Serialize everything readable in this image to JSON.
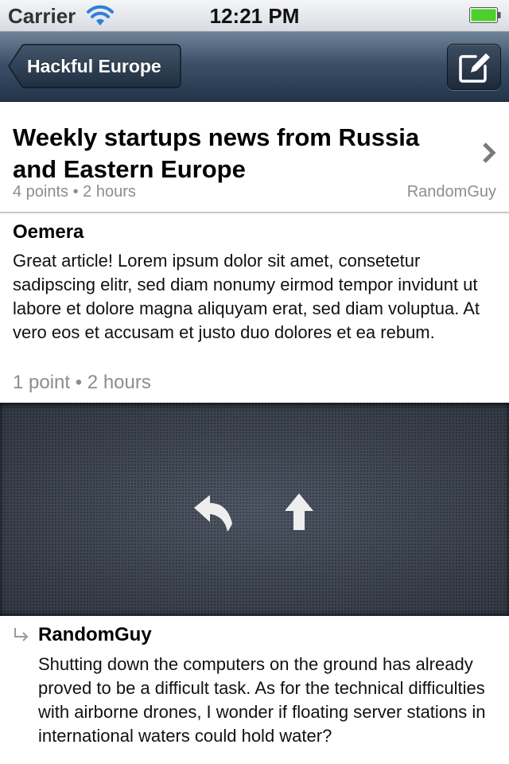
{
  "status_bar": {
    "carrier": "Carrier",
    "time": "12:21 PM",
    "wifi_icon": "wifi-icon",
    "battery_icon": "battery-icon"
  },
  "nav_bar": {
    "back_label": "Hackful Europe",
    "compose_icon": "compose-icon"
  },
  "story": {
    "title": "Weekly startups news from Russia and Eastern Europe",
    "meta": "4 points • 2 hours",
    "author": "RandomGuy",
    "chevron_icon": "chevron-right-icon"
  },
  "comments": [
    {
      "author": "Oemera",
      "text": "Great article! Lorem ipsum dolor sit amet, consetetur sadipscing elitr, sed diam nonumy eirmod tempor invidunt ut labore et dolore magna aliquyam erat, sed diam voluptua. At vero eos et accusam et justo duo dolores et ea rebum.",
      "meta": "1 point • 2 hours"
    },
    {
      "author": "RandomGuy",
      "text": "Shutting down the computers on the ground has already proved to be a difficult task. As for the technical difficulties with airborne drones, I wonder if floating server stations in international waters could hold water?",
      "reply_indicator_icon": "reply-indent-icon"
    }
  ],
  "action_panel": {
    "reply_icon": "reply-icon",
    "upvote_icon": "upvote-arrow-icon"
  },
  "colors": {
    "nav_bar": "#3c5068",
    "meta_text": "#8d8d8d",
    "battery": "#4cd02a",
    "action_panel": "#404651"
  }
}
